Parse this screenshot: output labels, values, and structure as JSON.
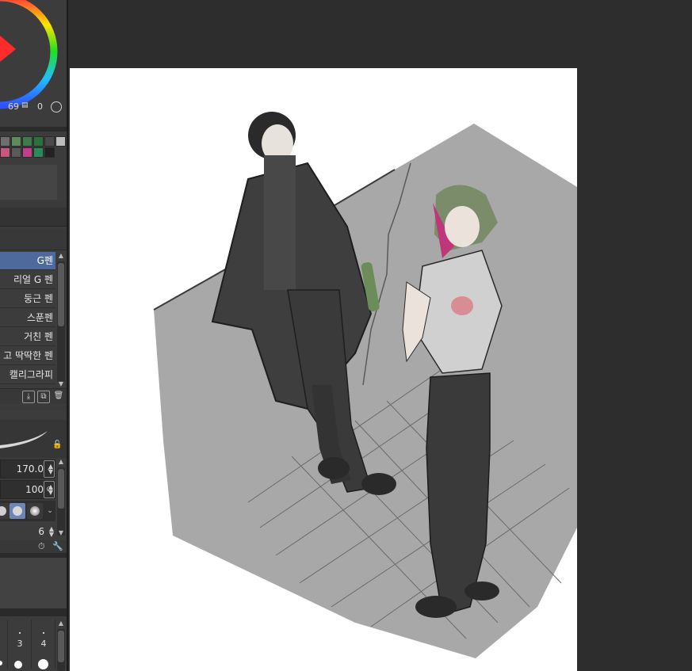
{
  "color_panel": {
    "readout": {
      "value_a": "69",
      "value_b": "0"
    },
    "palette_row1": [
      "#6e6e6e",
      "#5b8c5e",
      "#3e7a4a",
      "#2e6f3e",
      "#4a4a4a",
      "#bdbdbd"
    ],
    "palette_row2": [
      "#c7577f",
      "#5a5a5a",
      "#c13f8a",
      "#2a8a5a",
      "#222222"
    ]
  },
  "brush_list": {
    "items": [
      {
        "label": "G펜",
        "selected": true
      },
      {
        "label": "리얼 G 펜",
        "selected": false
      },
      {
        "label": "둥근 펜",
        "selected": false
      },
      {
        "label": "스푼펜",
        "selected": false
      },
      {
        "label": "거친 펜",
        "selected": false
      },
      {
        "label": "고 딱딱한 펜",
        "selected": false
      },
      {
        "label": "캘리그라피",
        "selected": false
      }
    ]
  },
  "tool_properties": {
    "brush_size": "170.0",
    "opacity": "100",
    "anti_alias": "6"
  },
  "brush_size_presets": {
    "labels": [
      "3",
      "4"
    ]
  },
  "colors": {
    "selected_accent": "#4e6a9c",
    "panel_bg": "#3c3c3c",
    "workspace_bg": "#2d2d2d"
  }
}
